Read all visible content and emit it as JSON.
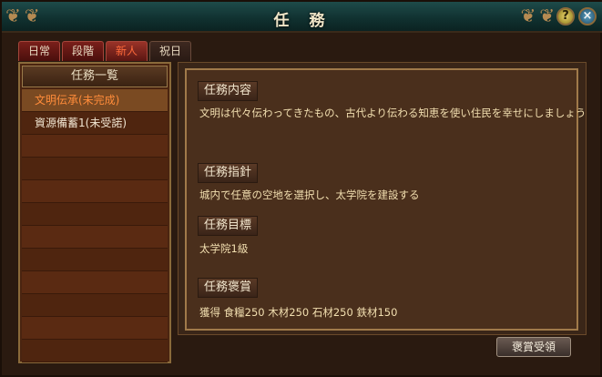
{
  "window": {
    "title": "任 務"
  },
  "tabs": [
    {
      "label": "日常"
    },
    {
      "label": "段階"
    },
    {
      "label": "新人"
    },
    {
      "label": "祝日"
    }
  ],
  "quest_list": {
    "header": "任務一覧",
    "items": [
      {
        "label": "文明伝承(未完成)"
      },
      {
        "label": "資源備蓄1(未受諾)"
      }
    ]
  },
  "detail": {
    "content_label": "任務内容",
    "content_text": "文明は代々伝わってきたもの、古代より伝わる知恵を使い住民を幸せにしましょう",
    "guide_label": "任務指針",
    "guide_text": "城内で任意の空地を選択し、太学院を建設する",
    "goal_label": "任務目標",
    "goal_text": "太学院1級",
    "reward_label": "任務褒賞",
    "reward_text": "獲得  食糧250  木材250  石材250  鉄材150"
  },
  "buttons": {
    "claim_reward": "褒賞受領",
    "help": "?",
    "close": "×"
  },
  "colors": {
    "selected_text": "#ff8c3a",
    "title_bar": "#1e4b4a"
  }
}
